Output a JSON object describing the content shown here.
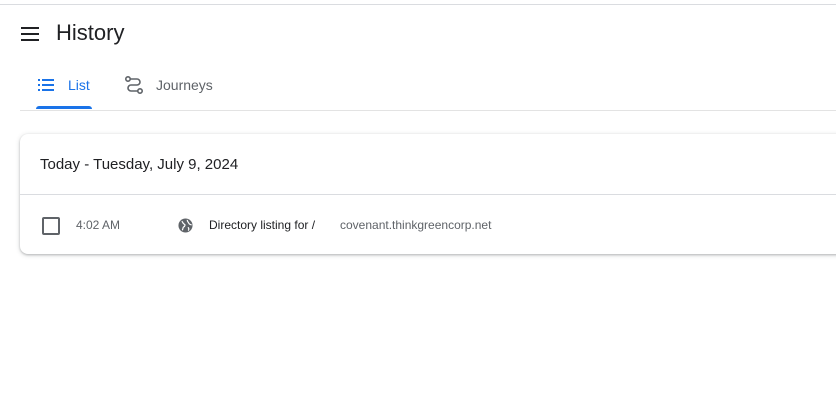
{
  "header": {
    "menu_icon": "hamburger-menu-icon",
    "title": "History"
  },
  "tabs": [
    {
      "label": "List",
      "icon": "list-icon",
      "selected": true
    },
    {
      "label": "Journeys",
      "icon": "journeys-icon",
      "selected": false
    }
  ],
  "history": {
    "date_heading": "Today - Tuesday, July 9, 2024",
    "entries": [
      {
        "checked": false,
        "time": "4:02 AM",
        "favicon": "globe-icon",
        "title": "Directory listing for /",
        "domain": "covenant.thinkgreencorp.net"
      }
    ]
  },
  "colors": {
    "accent": "#1a73e8",
    "text_primary": "#202124",
    "text_secondary": "#5f6368",
    "divider": "#dadce0"
  }
}
